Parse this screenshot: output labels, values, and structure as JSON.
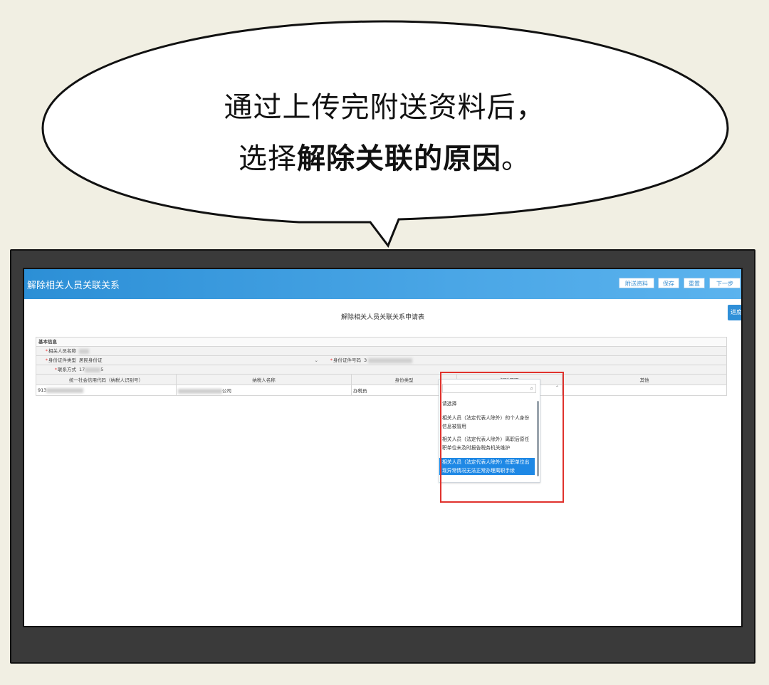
{
  "bubble": {
    "line1": "通过上传完附送资料后，",
    "line2_prefix": "选择",
    "line2_bold": "解除关联的原因",
    "line2_suffix": "。"
  },
  "app": {
    "title": "解除相关人员关联关系",
    "buttons": [
      "附送资料",
      "保存",
      "重置",
      "下一步"
    ],
    "progress_label": "进度",
    "form_title": "解除相关人员关联关系申请表"
  },
  "form": {
    "section": "基本信息",
    "fields": {
      "name_label": "相关人员名称",
      "id_type_label": "身份证件类型",
      "id_type_value": "居民身份证",
      "id_no_label": "身份证件号码",
      "id_no_value": "3",
      "contact_label": "联系方式",
      "contact_prefix": "17",
      "contact_suffix": "5"
    },
    "table": {
      "headers": [
        "统一社会信用代码（纳税人识别号）",
        "纳税人名称",
        "身份类型",
        "解除原因",
        "其他"
      ],
      "row": {
        "code_prefix": "913",
        "taxpayer_suffix": "公司",
        "identity": "办税员",
        "reason": "其他"
      }
    }
  },
  "dropdown": {
    "options": [
      "请选择",
      "相关人员（法定代表人除外）的个人身份信息被冒用",
      "相关人员（法定代表人除外）离职后原任职单位未及时报告税务机关维护",
      "相关人员（法定代表人除外）任职单位出现异常情况无法正常办理离职手续"
    ],
    "selected_index": 3
  },
  "colors": {
    "header_blue": "#2c8fd6",
    "highlight_red": "#e0322d",
    "selected_blue": "#1e88e5"
  }
}
